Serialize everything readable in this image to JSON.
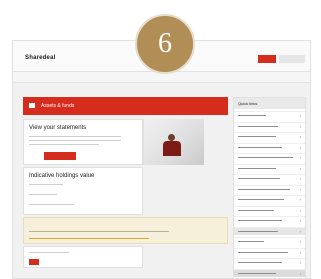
{
  "step_badge": {
    "number": "6"
  },
  "colors": {
    "accent": "#d62c1e",
    "badge": "#b08e55",
    "notice_bg": "#f6f0da"
  },
  "header": {
    "logo": "Sharedeal",
    "logo_sub": "",
    "logout_label": "",
    "contact_label": ""
  },
  "nav": {
    "items": [
      "",
      "",
      "",
      "",
      ""
    ]
  },
  "hero": {
    "title": "Assets & funds",
    "icon": "briefcase-icon"
  },
  "statements": {
    "title": "View your statements",
    "button_icon": "button"
  },
  "holdings": {
    "title": "Indicative holdings value"
  },
  "notice": {
    "title": "",
    "text": "",
    "link": ""
  },
  "quick_links": {
    "title": "Quick links",
    "items_count": 16
  }
}
